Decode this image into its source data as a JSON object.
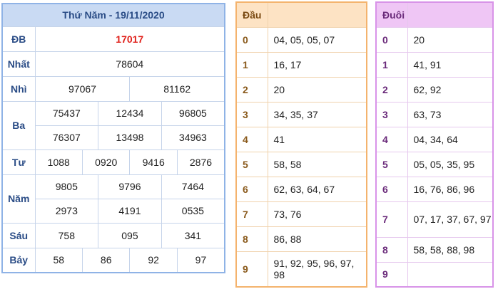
{
  "results": {
    "title": "Thứ Năm - 19/11/2020",
    "rows": [
      {
        "label": "ĐB",
        "values": [
          "17017"
        ]
      },
      {
        "label": "Nhất",
        "values": [
          "78604"
        ]
      },
      {
        "label": "Nhì",
        "values": [
          "97067",
          "81162"
        ]
      },
      {
        "label": "Ba",
        "values": [
          "75437",
          "12434",
          "96805",
          "76307",
          "13498",
          "34963"
        ]
      },
      {
        "label": "Tư",
        "values": [
          "1088",
          "0920",
          "9416",
          "2876"
        ]
      },
      {
        "label": "Năm",
        "values": [
          "9805",
          "9796",
          "7464",
          "2973",
          "4191",
          "0535"
        ]
      },
      {
        "label": "Sáu",
        "values": [
          "758",
          "095",
          "341"
        ]
      },
      {
        "label": "Bảy",
        "values": [
          "58",
          "86",
          "92",
          "97"
        ]
      }
    ],
    "special_color": "#e0201a"
  },
  "dau": {
    "title": "Đầu",
    "rows": [
      {
        "key": "0",
        "values": "04, 05, 05, 07"
      },
      {
        "key": "1",
        "values": "16, 17"
      },
      {
        "key": "2",
        "values": "20"
      },
      {
        "key": "3",
        "values": "34, 35, 37"
      },
      {
        "key": "4",
        "values": "41"
      },
      {
        "key": "5",
        "values": "58, 58"
      },
      {
        "key": "6",
        "values": "62, 63, 64, 67"
      },
      {
        "key": "7",
        "values": "73, 76"
      },
      {
        "key": "8",
        "values": "86, 88"
      },
      {
        "key": "9",
        "values": "91, 92, 95, 96, 97, 98"
      }
    ],
    "accent": "#f4b36d"
  },
  "duoi": {
    "title": "Đuôi",
    "rows": [
      {
        "key": "0",
        "values": "20"
      },
      {
        "key": "1",
        "values": "41, 91"
      },
      {
        "key": "2",
        "values": "62, 92"
      },
      {
        "key": "3",
        "values": "63, 73"
      },
      {
        "key": "4",
        "values": "04, 34, 64"
      },
      {
        "key": "5",
        "values": "05, 05, 35, 95"
      },
      {
        "key": "6",
        "values": "16, 76, 86, 96"
      },
      {
        "key": "7",
        "values": "07, 17, 37, 67, 97"
      },
      {
        "key": "8",
        "values": "58, 58, 88, 98"
      },
      {
        "key": "9",
        "values": ""
      }
    ],
    "accent": "#d893e8"
  }
}
